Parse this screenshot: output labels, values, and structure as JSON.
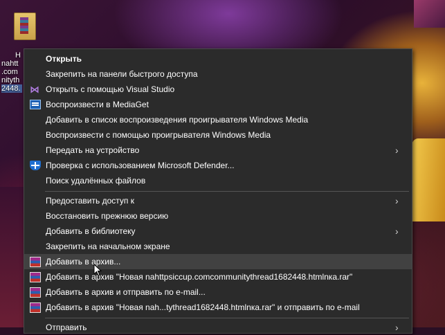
{
  "desktop": {
    "icon_label_lines": [
      "H",
      "nahtt",
      ".com",
      "nityth",
      "2448."
    ]
  },
  "menu": {
    "items": [
      {
        "label": "Открыть",
        "bold": true,
        "icon": "",
        "submenu": false
      },
      {
        "label": "Закрепить на панели быстрого доступа",
        "icon": "",
        "submenu": false
      },
      {
        "label": "Открыть с помощью Visual Studio",
        "icon": "visual-studio-icon",
        "submenu": false
      },
      {
        "label": "Воспроизвести в MediaGet",
        "icon": "mediaget-icon",
        "submenu": false
      },
      {
        "label": "Добавить в список воспроизведения проигрывателя Windows Media",
        "icon": "",
        "submenu": false
      },
      {
        "label": "Воспроизвести с помощью проигрывателя Windows Media",
        "icon": "",
        "submenu": false
      },
      {
        "label": "Передать на устройство",
        "icon": "",
        "submenu": true
      },
      {
        "label": "Проверка с использованием Microsoft Defender...",
        "icon": "defender-icon",
        "submenu": false
      },
      {
        "label": "Поиск удалённых файлов",
        "icon": "",
        "submenu": false
      },
      {
        "label": "Предоставить доступ к",
        "icon": "",
        "submenu": true
      },
      {
        "label": "Восстановить прежнюю версию",
        "icon": "",
        "submenu": false
      },
      {
        "label": "Добавить в библиотеку",
        "icon": "",
        "submenu": true
      },
      {
        "label": "Закрепить на начальном экране",
        "icon": "",
        "submenu": false
      },
      {
        "label": "Добавить в архив...",
        "icon": "winrar-icon",
        "submenu": false,
        "hover": true
      },
      {
        "label": "Добавить в архив \"Новая nahttpsiccup.comcommunitythread1682448.htmlnка.rar\"",
        "icon": "winrar-icon",
        "submenu": false
      },
      {
        "label": "Добавить в архив и отправить по e-mail...",
        "icon": "winrar-icon",
        "submenu": false
      },
      {
        "label": "Добавить в архив \"Новая nah...tythread1682448.htmlnка.rar\" и отправить по e-mail",
        "icon": "winrar-icon",
        "submenu": false
      },
      {
        "label": "Отправить",
        "icon": "",
        "submenu": true
      }
    ]
  },
  "colors": {
    "menu_bg": "#2b2b2b",
    "menu_hover": "#414141",
    "menu_text": "#ffffff",
    "separator": "#555555"
  }
}
